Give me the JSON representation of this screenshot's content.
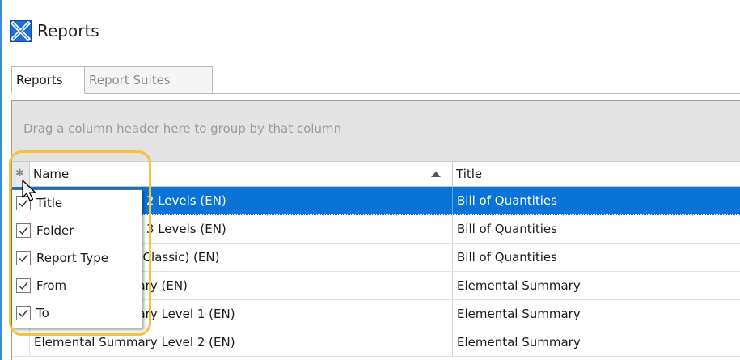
{
  "window": {
    "title": "Reports",
    "app_icon": "close-box-icon",
    "accent_color": "#3a8ed6"
  },
  "tabs": [
    {
      "label": "Reports",
      "active": true
    },
    {
      "label": "Report Suites",
      "active": false
    }
  ],
  "grid": {
    "group_panel_text": "Drag a column header here to group by that column",
    "column_chooser_icon": "asterisk-icon",
    "columns": [
      {
        "label": "Name",
        "sort": "ascending"
      },
      {
        "label": "Title"
      }
    ],
    "rows": [
      {
        "name": "Bill of Quantities - 2 Levels (EN)",
        "title": "Bill of Quantities",
        "selected": true
      },
      {
        "name": "Bill of Quantities - 3 Levels (EN)",
        "title": "Bill of Quantities",
        "selected": false
      },
      {
        "name": "Bill of Quantities (Classic) (EN)",
        "title": "Bill of Quantities",
        "selected": false
      },
      {
        "name": "Elemental Summary (EN)",
        "title": "Elemental Summary",
        "selected": false
      },
      {
        "name": "Elemental Summary Level 1 (EN)",
        "title": "Elemental Summary",
        "selected": false
      },
      {
        "name": "Elemental Summary Level 2 (EN)",
        "title": "Elemental Summary",
        "selected": false
      }
    ],
    "selected_row_color": "#0a73d8"
  },
  "column_chooser": {
    "items": [
      {
        "label": "Title",
        "checked": true
      },
      {
        "label": "Folder",
        "checked": true
      },
      {
        "label": "Report Type",
        "checked": true
      },
      {
        "label": "From",
        "checked": true
      },
      {
        "label": "To",
        "checked": true
      }
    ],
    "highlight_color": "#f6c23c"
  }
}
